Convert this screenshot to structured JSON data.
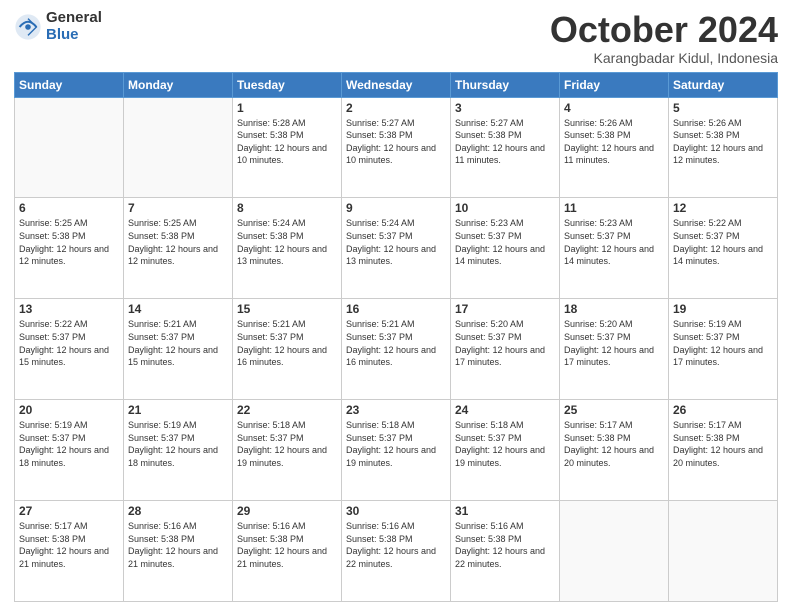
{
  "logo": {
    "general": "General",
    "blue": "Blue"
  },
  "header": {
    "month": "October 2024",
    "location": "Karangbadar Kidul, Indonesia"
  },
  "weekdays": [
    "Sunday",
    "Monday",
    "Tuesday",
    "Wednesday",
    "Thursday",
    "Friday",
    "Saturday"
  ],
  "weeks": [
    [
      {
        "day": null
      },
      {
        "day": null
      },
      {
        "day": 1,
        "sunrise": "5:28 AM",
        "sunset": "5:38 PM",
        "daylight": "12 hours and 10 minutes."
      },
      {
        "day": 2,
        "sunrise": "5:27 AM",
        "sunset": "5:38 PM",
        "daylight": "12 hours and 10 minutes."
      },
      {
        "day": 3,
        "sunrise": "5:27 AM",
        "sunset": "5:38 PM",
        "daylight": "12 hours and 11 minutes."
      },
      {
        "day": 4,
        "sunrise": "5:26 AM",
        "sunset": "5:38 PM",
        "daylight": "12 hours and 11 minutes."
      },
      {
        "day": 5,
        "sunrise": "5:26 AM",
        "sunset": "5:38 PM",
        "daylight": "12 hours and 12 minutes."
      }
    ],
    [
      {
        "day": 6,
        "sunrise": "5:25 AM",
        "sunset": "5:38 PM",
        "daylight": "12 hours and 12 minutes."
      },
      {
        "day": 7,
        "sunrise": "5:25 AM",
        "sunset": "5:38 PM",
        "daylight": "12 hours and 12 minutes."
      },
      {
        "day": 8,
        "sunrise": "5:24 AM",
        "sunset": "5:38 PM",
        "daylight": "12 hours and 13 minutes."
      },
      {
        "day": 9,
        "sunrise": "5:24 AM",
        "sunset": "5:37 PM",
        "daylight": "12 hours and 13 minutes."
      },
      {
        "day": 10,
        "sunrise": "5:23 AM",
        "sunset": "5:37 PM",
        "daylight": "12 hours and 14 minutes."
      },
      {
        "day": 11,
        "sunrise": "5:23 AM",
        "sunset": "5:37 PM",
        "daylight": "12 hours and 14 minutes."
      },
      {
        "day": 12,
        "sunrise": "5:22 AM",
        "sunset": "5:37 PM",
        "daylight": "12 hours and 14 minutes."
      }
    ],
    [
      {
        "day": 13,
        "sunrise": "5:22 AM",
        "sunset": "5:37 PM",
        "daylight": "12 hours and 15 minutes."
      },
      {
        "day": 14,
        "sunrise": "5:21 AM",
        "sunset": "5:37 PM",
        "daylight": "12 hours and 15 minutes."
      },
      {
        "day": 15,
        "sunrise": "5:21 AM",
        "sunset": "5:37 PM",
        "daylight": "12 hours and 16 minutes."
      },
      {
        "day": 16,
        "sunrise": "5:21 AM",
        "sunset": "5:37 PM",
        "daylight": "12 hours and 16 minutes."
      },
      {
        "day": 17,
        "sunrise": "5:20 AM",
        "sunset": "5:37 PM",
        "daylight": "12 hours and 17 minutes."
      },
      {
        "day": 18,
        "sunrise": "5:20 AM",
        "sunset": "5:37 PM",
        "daylight": "12 hours and 17 minutes."
      },
      {
        "day": 19,
        "sunrise": "5:19 AM",
        "sunset": "5:37 PM",
        "daylight": "12 hours and 17 minutes."
      }
    ],
    [
      {
        "day": 20,
        "sunrise": "5:19 AM",
        "sunset": "5:37 PM",
        "daylight": "12 hours and 18 minutes."
      },
      {
        "day": 21,
        "sunrise": "5:19 AM",
        "sunset": "5:37 PM",
        "daylight": "12 hours and 18 minutes."
      },
      {
        "day": 22,
        "sunrise": "5:18 AM",
        "sunset": "5:37 PM",
        "daylight": "12 hours and 19 minutes."
      },
      {
        "day": 23,
        "sunrise": "5:18 AM",
        "sunset": "5:37 PM",
        "daylight": "12 hours and 19 minutes."
      },
      {
        "day": 24,
        "sunrise": "5:18 AM",
        "sunset": "5:37 PM",
        "daylight": "12 hours and 19 minutes."
      },
      {
        "day": 25,
        "sunrise": "5:17 AM",
        "sunset": "5:38 PM",
        "daylight": "12 hours and 20 minutes."
      },
      {
        "day": 26,
        "sunrise": "5:17 AM",
        "sunset": "5:38 PM",
        "daylight": "12 hours and 20 minutes."
      }
    ],
    [
      {
        "day": 27,
        "sunrise": "5:17 AM",
        "sunset": "5:38 PM",
        "daylight": "12 hours and 21 minutes."
      },
      {
        "day": 28,
        "sunrise": "5:16 AM",
        "sunset": "5:38 PM",
        "daylight": "12 hours and 21 minutes."
      },
      {
        "day": 29,
        "sunrise": "5:16 AM",
        "sunset": "5:38 PM",
        "daylight": "12 hours and 21 minutes."
      },
      {
        "day": 30,
        "sunrise": "5:16 AM",
        "sunset": "5:38 PM",
        "daylight": "12 hours and 22 minutes."
      },
      {
        "day": 31,
        "sunrise": "5:16 AM",
        "sunset": "5:38 PM",
        "daylight": "12 hours and 22 minutes."
      },
      {
        "day": null
      },
      {
        "day": null
      }
    ]
  ]
}
